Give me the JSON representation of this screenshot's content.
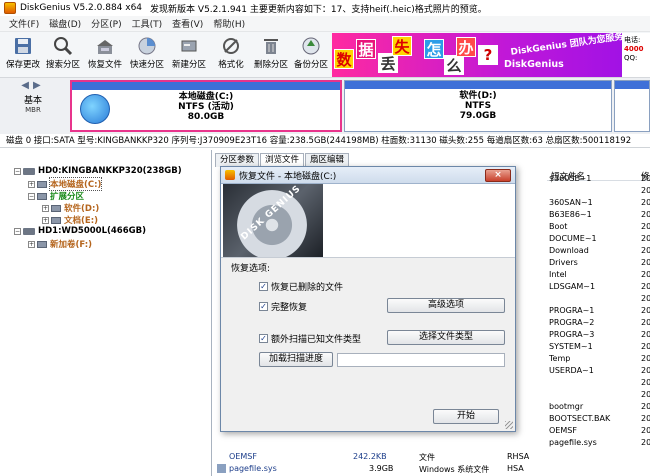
{
  "title": {
    "app": "DiskGenius V5.2.0.884 x64",
    "update": "发现新版本 V5.2.1.941 主要更新内容如下：17、支持heif(.heic)格式照片的预览。"
  },
  "menu": [
    "文件(F)",
    "磁盘(D)",
    "分区(P)",
    "工具(T)",
    "查看(V)",
    "帮助(H)"
  ],
  "toolbar": [
    {
      "label": "保存更改",
      "icon": "save-icon"
    },
    {
      "label": "搜索分区",
      "icon": "magnifier-icon"
    },
    {
      "label": "恢复文件",
      "icon": "recover-files-icon"
    },
    {
      "label": "快速分区",
      "icon": "quick-partition-icon"
    },
    {
      "label": "新建分区",
      "icon": "new-partition-icon"
    },
    {
      "label": "格式化",
      "icon": "format-icon"
    },
    {
      "label": "删除分区",
      "icon": "trash-icon"
    },
    {
      "label": "备份分区",
      "icon": "backup-icon"
    }
  ],
  "banner": {
    "tiles": [
      "数",
      "据",
      "丢",
      "失",
      "怎",
      "么",
      "办",
      "?"
    ],
    "slogan": "DiskGenius 团队为您服务",
    "brand": "DiskGenius",
    "corner_lines": [
      "电话:",
      "4000",
      "QQ:"
    ]
  },
  "disk_nav": {
    "line1": "基本",
    "line2": "MBR"
  },
  "partitions": [
    {
      "name": "本地磁盘(C:)",
      "fs": "NTFS (活动)",
      "size": "80.0GB"
    },
    {
      "name": "软件(D:)",
      "fs": "NTFS",
      "size": "79.0GB"
    }
  ],
  "disk_info": "磁盘 0 接口:SATA 型号:KINGBANKKP320 序列号:J370909E23T16 容量:238.5GB(244198MB) 柱面数:31130 磁头数:255 每道扇区数:63 总扇区数:500118192",
  "tree": [
    {
      "label": "HD0:KINGBANKKP320(238GB)",
      "pm": "−"
    },
    {
      "label": "本地磁盘(C:)",
      "pm": "+"
    },
    {
      "label": "扩展分区",
      "pm": "−"
    },
    {
      "label": "软件(D:)",
      "pm": "+"
    },
    {
      "label": "文档(E:)",
      "pm": "+"
    },
    {
      "label": "HD1:WD5000L(466GB)",
      "pm": "−"
    },
    {
      "label": "新加卷(F:)",
      "pm": "+"
    }
  ],
  "tabs": [
    "分区参数",
    "浏览文件",
    "扇区编辑"
  ],
  "list": {
    "short_header": "短文件名",
    "mod_header": "修",
    "short_names": [
      "$360SE~1",
      "",
      "360SAN~1",
      "B63E86~1",
      "Boot",
      "DOCUME~1",
      "Download",
      "Drivers",
      "Intel",
      "LDSGAM~1",
      "",
      "PROGRA~1",
      "PROGRA~2",
      "PROGRA~3",
      "SYSTEM~1",
      "Temp",
      "USERDA~1",
      "",
      "",
      "bootmgr",
      "BOOTSECT.BAK",
      "OEMSF",
      "pagefile.sys"
    ],
    "mod_values": [
      "20",
      "20",
      "20",
      "20",
      "20",
      "20",
      "20",
      "20",
      "20",
      "20",
      "20",
      "20",
      "20",
      "20",
      "20",
      "20",
      "20",
      "20",
      "20",
      "20",
      "20",
      "20",
      "20"
    ],
    "rows": [
      {
        "name": "OEMSF",
        "size": "242.2KB",
        "type": "文件",
        "attr": "RHSA"
      },
      {
        "name": "pagefile.sys",
        "size": "3.9GB",
        "type": "Windows 系统文件",
        "attr": "HSA"
      }
    ]
  },
  "dialog": {
    "title": "恢复文件 - 本地磁盘(C:)",
    "close": "×",
    "banner_text": "DISK GENIUS",
    "options_title": "恢复选项:",
    "opt_deleted": "恢复已删除的文件",
    "opt_complete": "完整恢复",
    "opt_known": "额外扫描已知文件类型",
    "check": "✓",
    "advanced": "高级选项",
    "select_types": "选择文件类型",
    "load_progress": "加载扫描进度",
    "start": "开始"
  }
}
